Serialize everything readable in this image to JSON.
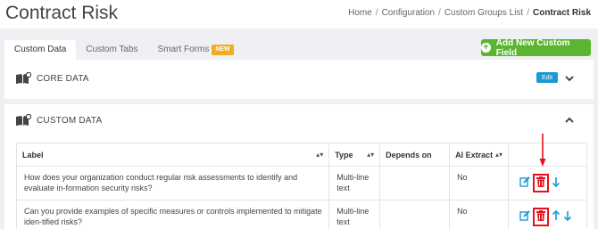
{
  "header": {
    "title": "Contract Risk",
    "breadcrumb": [
      "Home",
      "Configuration",
      "Custom Groups List",
      "Contract Risk"
    ],
    "separator": "/"
  },
  "tabs": [
    {
      "label": "Custom Data",
      "active": true
    },
    {
      "label": "Custom Tabs",
      "active": false
    },
    {
      "label": "Smart Forms",
      "active": false,
      "badge": "NEW"
    }
  ],
  "add_button": "Add New Custom Field",
  "core_section": {
    "title": "CORE DATA",
    "edit_label": "Edit"
  },
  "custom_section": {
    "title": "CUSTOM DATA"
  },
  "table": {
    "columns": [
      "Label",
      "Type",
      "Depends on",
      "AI Extract",
      ""
    ],
    "rows": [
      {
        "label": "How does your organization conduct regular risk assessments to identify and evaluate in-formation security risks?",
        "type": "Multi-line text",
        "depends_on": "",
        "ai_extract": "No"
      },
      {
        "label": "Can you provide examples of specific measures or controls implemented to mitigate iden-tified risks?",
        "type": "Multi-line text",
        "depends_on": "",
        "ai_extract": "No"
      }
    ]
  },
  "colors": {
    "accent_green": "#5cb531",
    "accent_blue": "#1a9ad6",
    "delete_red": "#e8101b",
    "badge_orange": "#f0ad1e"
  },
  "icons": [
    "book-icon",
    "chevron-down-icon",
    "chevron-up-icon",
    "sort-icon",
    "edit-icon",
    "trash-icon",
    "arrow-up-icon",
    "arrow-down-icon",
    "plus-icon"
  ]
}
